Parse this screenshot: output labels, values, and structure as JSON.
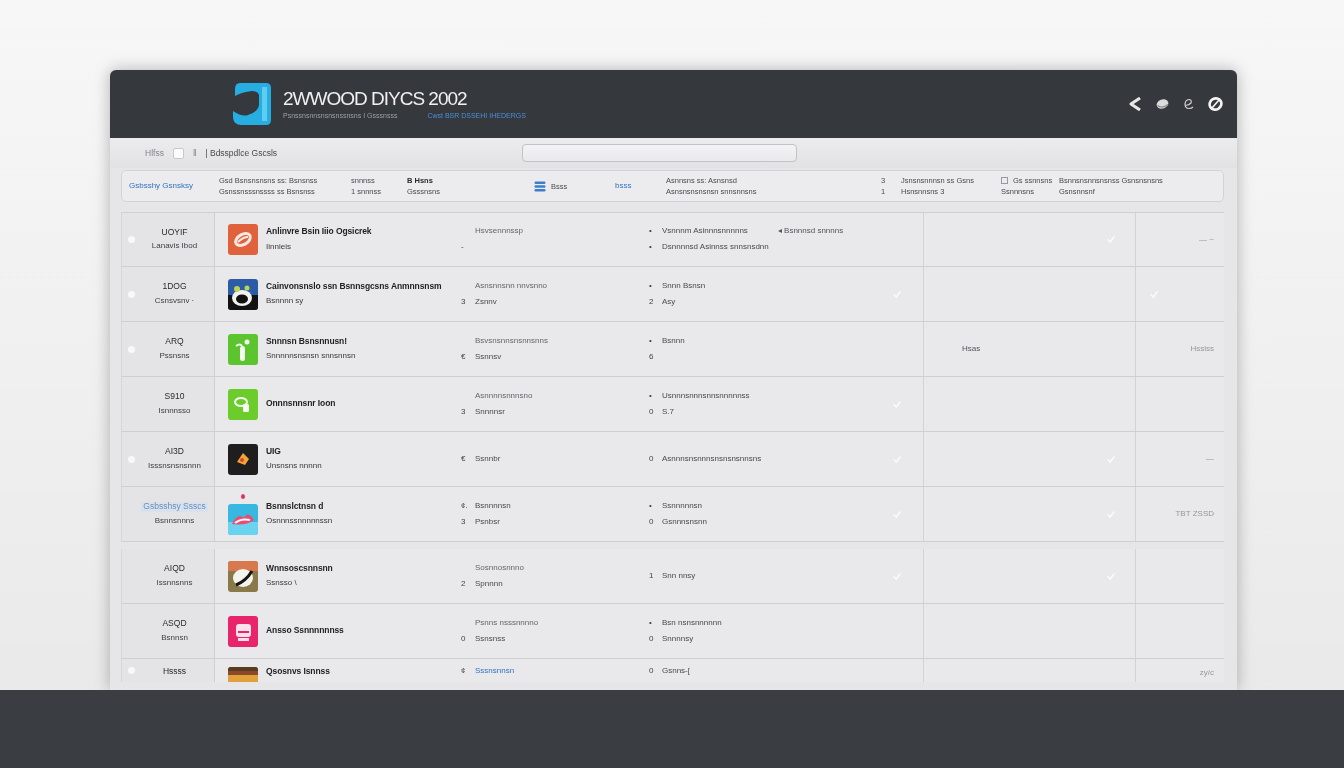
{
  "header": {
    "title": "2WWOOD DIYCS 2002",
    "tagline": "Psnssnsnnsnsnsnssnsns I Gsssnsss",
    "tagline_link": "Cwst BSR DSSEHI IHEDERGS"
  },
  "toolbar": {
    "label": "Hlfss",
    "checked": false,
    "separator": "‖",
    "crumb": "| Bdsspdlce Gscsls"
  },
  "filters": [
    {
      "kind": "link",
      "lines": [
        "Gsbsshy Gsnsksy"
      ]
    },
    {
      "kind": "lines",
      "lines": [
        "Gsd Bsnsnsnsns ss: Bsnsnss",
        "Gsnssnsssnssss ss Bsnsnss"
      ]
    },
    {
      "kind": "lines",
      "lines": [
        "snnnss",
        "1 snnnss"
      ]
    },
    {
      "kind": "heading",
      "lines": [
        "B Hsns",
        "Gsssnsns"
      ]
    },
    {
      "kind": "stack",
      "lines": [
        "Bsss"
      ]
    },
    {
      "kind": "link",
      "lines": [
        "bsss"
      ]
    },
    {
      "kind": "lines",
      "lines": [
        "Asnnsns ss: Asnsnsd",
        "Asnsnsnsnsnsn snnsnnsns"
      ]
    },
    {
      "kind": "lines",
      "lines": [
        "3",
        "1"
      ]
    },
    {
      "kind": "lines",
      "lines": [
        "Jsnsnsnnnsn ss Gsns",
        "Hsnsnnsns 3"
      ]
    },
    {
      "kind": "boxed",
      "lines": [
        "Gs ssnnsns",
        "Ssnnnsns"
      ]
    },
    {
      "kind": "lines",
      "lines": [
        "Bsnnsnsnnsnsnss Gsnsnsnsns",
        "Gsnsnnsnf"
      ]
    }
  ],
  "rows": [
    {
      "bullet": true,
      "code": "UOYIF",
      "code_highlighted": false,
      "code_sub": "Lanavis Ibod",
      "notice_dot": false,
      "icon": {
        "kind": "swirl",
        "color": "#e0623c"
      },
      "title": "Anlinvre Bsin Iiio Ogsicrek",
      "subtitle": "Iinnieis",
      "col3": [
        {
          "text": "Hsvsennnssp"
        },
        {
          "marker": "-"
        }
      ],
      "col4": [
        {
          "marker": "•",
          "text": "Vsnnnm Asinnnsnnnnns",
          "note": "◂ Bsnnnsd snnnns"
        },
        {
          "marker": "•",
          "text": "Dsnnnnsd Asinnss snnsnsdnn"
        }
      ],
      "col4_tick": false,
      "col5_tick": true,
      "side_tick": false,
      "side": "— ~"
    },
    {
      "bullet": true,
      "code": "1DOG",
      "code_highlighted": false,
      "code_sub": "Csnsvsnv ·",
      "notice_dot": false,
      "icon": {
        "kind": "creature",
        "color": "#2c5ca8"
      },
      "title": "Cainvonsnslo ssn Bsnnsgcsns Anmnnsnsm",
      "subtitle": "Bsnnnn sy",
      "col3": [
        {
          "text": "Asnsnnsnn nnvsnno"
        },
        {
          "marker": "3",
          "text": "Zsnnv"
        }
      ],
      "col4": [
        {
          "marker": "•",
          "text": "Snnn Bsnsn"
        },
        {
          "marker": "2",
          "text": "Asy"
        }
      ],
      "col4_tick": true,
      "col5_tick": false,
      "side_tick": true
    },
    {
      "bullet": true,
      "code": "ARQ",
      "code_highlighted": false,
      "code_sub": "Pssnsns",
      "notice_dot": false,
      "icon": {
        "kind": "sprout",
        "color": "#5cc42e"
      },
      "title": "Snnnsn Bsnsnnusn!",
      "subtitle": "Snnnnnsnsnsn snnsnnsn",
      "col3": [
        {
          "text": "Bsvsnsnnsnsnnsnns"
        },
        {
          "marker": "€",
          "text": "Ssnnsv"
        }
      ],
      "col4": [
        {
          "marker": "•",
          "text": "Bsnnn"
        },
        {
          "marker": "6"
        }
      ],
      "col5": "Hsas",
      "col4_tick": false,
      "col5_tick": false,
      "side_tick": false,
      "side": "Hsslss"
    },
    {
      "bullet": false,
      "code": "S910",
      "code_highlighted": false,
      "code_sub": "Isnnnsso",
      "notice_dot": false,
      "icon": {
        "kind": "loop",
        "color": "#6ccc2c"
      },
      "title": "Onnnsnnsnr Ioon",
      "col3": [
        {
          "text": "Asnnnnsnnnsno"
        },
        {
          "marker": "3",
          "text": "Snnnnsr"
        }
      ],
      "col4": [
        {
          "marker": "•",
          "text": "Usnnnsnnnsnnsnnnnnss"
        },
        {
          "marker": "0",
          "text": "S.7"
        }
      ],
      "col4_tick": true,
      "col5_tick": false,
      "side_tick": false
    },
    {
      "bullet": true,
      "code": "AI3D",
      "code_highlighted": false,
      "code_sub": "Isssnsnsnsnnn",
      "notice_dot": false,
      "icon": {
        "kind": "diamond",
        "color": "#1e1e1e"
      },
      "title": "UIG",
      "subtitle": "Unsnsns nnnnn",
      "col3": [
        {
          "marker": "€",
          "text": "Ssnnbr"
        }
      ],
      "col4": [
        {
          "marker": "0",
          "text": "Asnnnsnsnnnsnsnsnsnnsns"
        }
      ],
      "col4_tick": true,
      "col5_tick": true,
      "side_tick": false,
      "side": "—"
    },
    {
      "bullet": false,
      "code": "Gsbsshsy Ssscs",
      "code_highlighted": true,
      "code_sub": "Bsnnsnnns",
      "notice_dot": true,
      "icon": {
        "kind": "lips",
        "color": "#36b8e0"
      },
      "title": "Bsnnslctnsn d",
      "subtitle": "Osnnnssnnnnnssn",
      "col3": [
        {
          "marker": "¢.",
          "text": "Bsnnnnsn"
        },
        {
          "marker": "3",
          "text": "Psnbsr"
        }
      ],
      "col4": [
        {
          "marker": "•",
          "text": "Ssnnnnnsn"
        },
        {
          "marker": "0",
          "text": "Gsnnnsnsnn"
        }
      ],
      "col4_tick": true,
      "col5_tick": true,
      "side_tick": false,
      "side": "TBT ZSSD"
    },
    {
      "bullet": false,
      "code": "AIQD",
      "code_highlighted": false,
      "code_sub": "Issnnsnns",
      "notice_dot": false,
      "icon": {
        "kind": "ball",
        "color": "#8a7a4a"
      },
      "title": "Wnnsoscsnnsnn",
      "subtitle": "Ssnsso \\",
      "col3": [
        {
          "text": "Sosnnosnnno"
        },
        {
          "marker": "2",
          "text": "Spnnnn"
        }
      ],
      "col4": [
        {
          "marker": "1",
          "text": "Snn nnsy"
        }
      ],
      "col4_tick": true,
      "col5_tick": true,
      "side_tick": false
    },
    {
      "bullet": false,
      "code": "ASQD",
      "code_highlighted": false,
      "code_sub": "Bsnnsn",
      "notice_dot": false,
      "icon": {
        "kind": "ticket",
        "color": "#e8246a"
      },
      "title": "Ansso Ssnnnnnnss",
      "col3": [
        {
          "text": "Psnns nsssnnnno"
        },
        {
          "marker": "0",
          "text": "Ssnsnss"
        }
      ],
      "col4": [
        {
          "marker": "•",
          "text": "Bsn nsnsnnnnnn"
        },
        {
          "marker": "0",
          "text": "Snnnnsy"
        }
      ],
      "col4_tick": false,
      "col5_tick": false,
      "side_tick": false
    },
    {
      "bullet": true,
      "code": "Hssss",
      "code_highlighted": false,
      "notice_dot": false,
      "icon": {
        "kind": "stripes",
        "color": "#8a4a2a"
      },
      "title": "Qsosnvs Isnnss",
      "col3": [
        {
          "marker": "¢",
          "text": "Sssnsnnsn",
          "link": true
        }
      ],
      "col4": [
        {
          "marker": "0",
          "text": "Gsnns-["
        }
      ],
      "col4_tick": false,
      "col5_tick": false,
      "side_tick": false,
      "side": "zy/c"
    }
  ]
}
